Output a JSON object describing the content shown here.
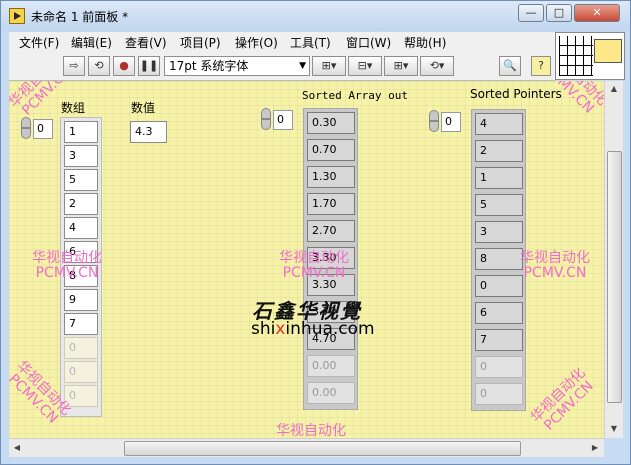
{
  "window": {
    "title": "未命名 1 前面板 *",
    "min_label": "—",
    "max_label": "□",
    "close_label": "✕"
  },
  "menu": [
    "文件(F)",
    "编辑(E)",
    "查看(V)",
    "项目(P)",
    "操作(O)",
    "工具(T)",
    "窗口(W)",
    "帮助(H)"
  ],
  "toolbar": {
    "run": "⇨",
    "run_continuous": "⟲",
    "abort": "●",
    "pause": "❚❚",
    "font": "17pt 系统字体",
    "align": "⊞▾",
    "distribute": "⊟▾",
    "resize": "⊞▾",
    "reorder": "⟲▾",
    "search": "🔍",
    "help": "?"
  },
  "front_panel": {
    "array1": {
      "label": "数组",
      "index": "0",
      "values": [
        "1",
        "3",
        "5",
        "2",
        "4",
        "6",
        "8",
        "9",
        "7",
        "0",
        "0",
        "0"
      ]
    },
    "numeric": {
      "label": "数值",
      "value": "4.3"
    },
    "sorted_out": {
      "label": "Sorted Array out",
      "index": "0",
      "values": [
        "0.30",
        "0.70",
        "1.30",
        "1.70",
        "2.70",
        "3.30",
        "3.30",
        "3.70",
        "4.70",
        "0.00",
        "0.00"
      ]
    },
    "sorted_ptr": {
      "label": "Sorted Pointers",
      "index": "0",
      "values": [
        "4",
        "2",
        "1",
        "5",
        "3",
        "8",
        "0",
        "6",
        "7",
        "0",
        "0"
      ]
    }
  },
  "watermarks": {
    "cn": "华视自动化",
    "en": "PCMV.CN",
    "logo_cn": "石鑫华视覺",
    "logo_prefix": "shi",
    "logo_x": "x",
    "logo_suffix": "inhua.com"
  }
}
